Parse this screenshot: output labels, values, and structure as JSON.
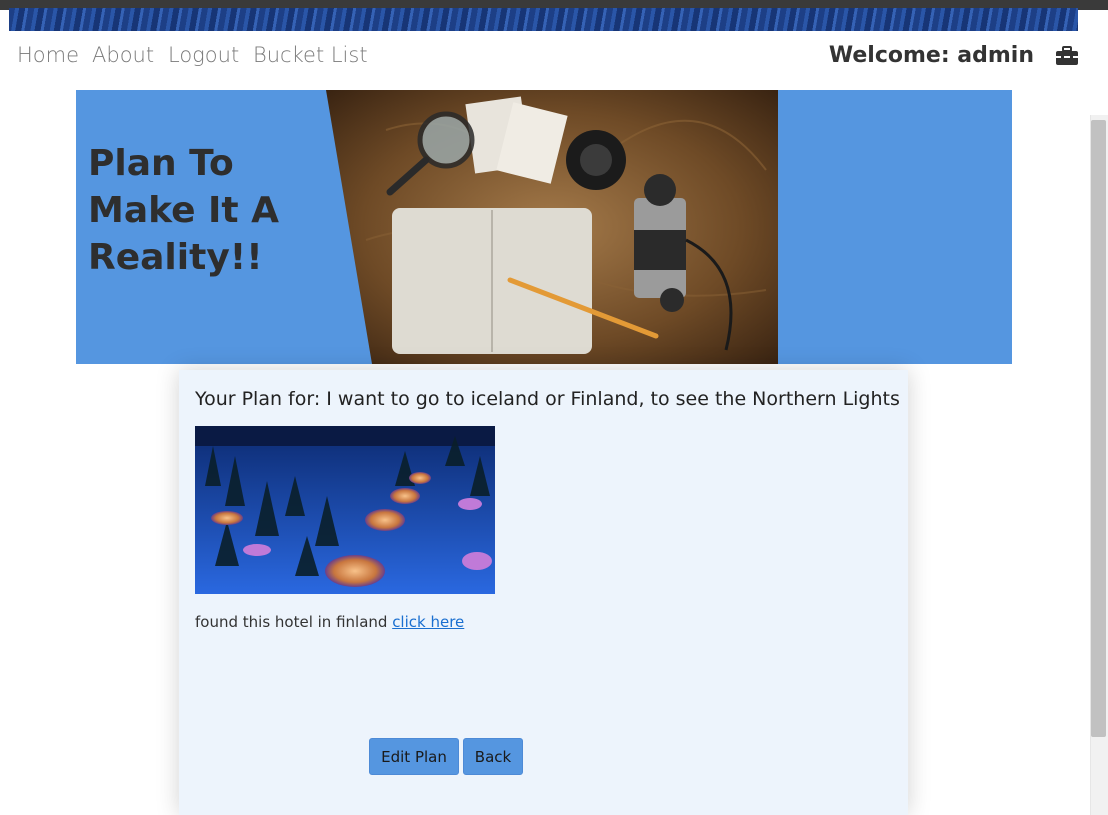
{
  "nav": {
    "links": [
      "Home",
      "About",
      "Logout",
      "Bucket List"
    ],
    "welcome": "Welcome: admin",
    "toolbox_icon": "toolbox-icon"
  },
  "hero": {
    "title": "Plan To Make It A Reality!!",
    "background": "#5596e0"
  },
  "plan": {
    "heading": "Your Plan for: I want to go to iceland or Finland, to see the Northern Lights",
    "note_text": "found this hotel in finland ",
    "link_text": "click here",
    "buttons": {
      "edit": "Edit Plan",
      "back": "Back"
    }
  },
  "colors": {
    "accent": "#5596e0",
    "card": "#edf4fc",
    "link": "#1a6fd0"
  }
}
